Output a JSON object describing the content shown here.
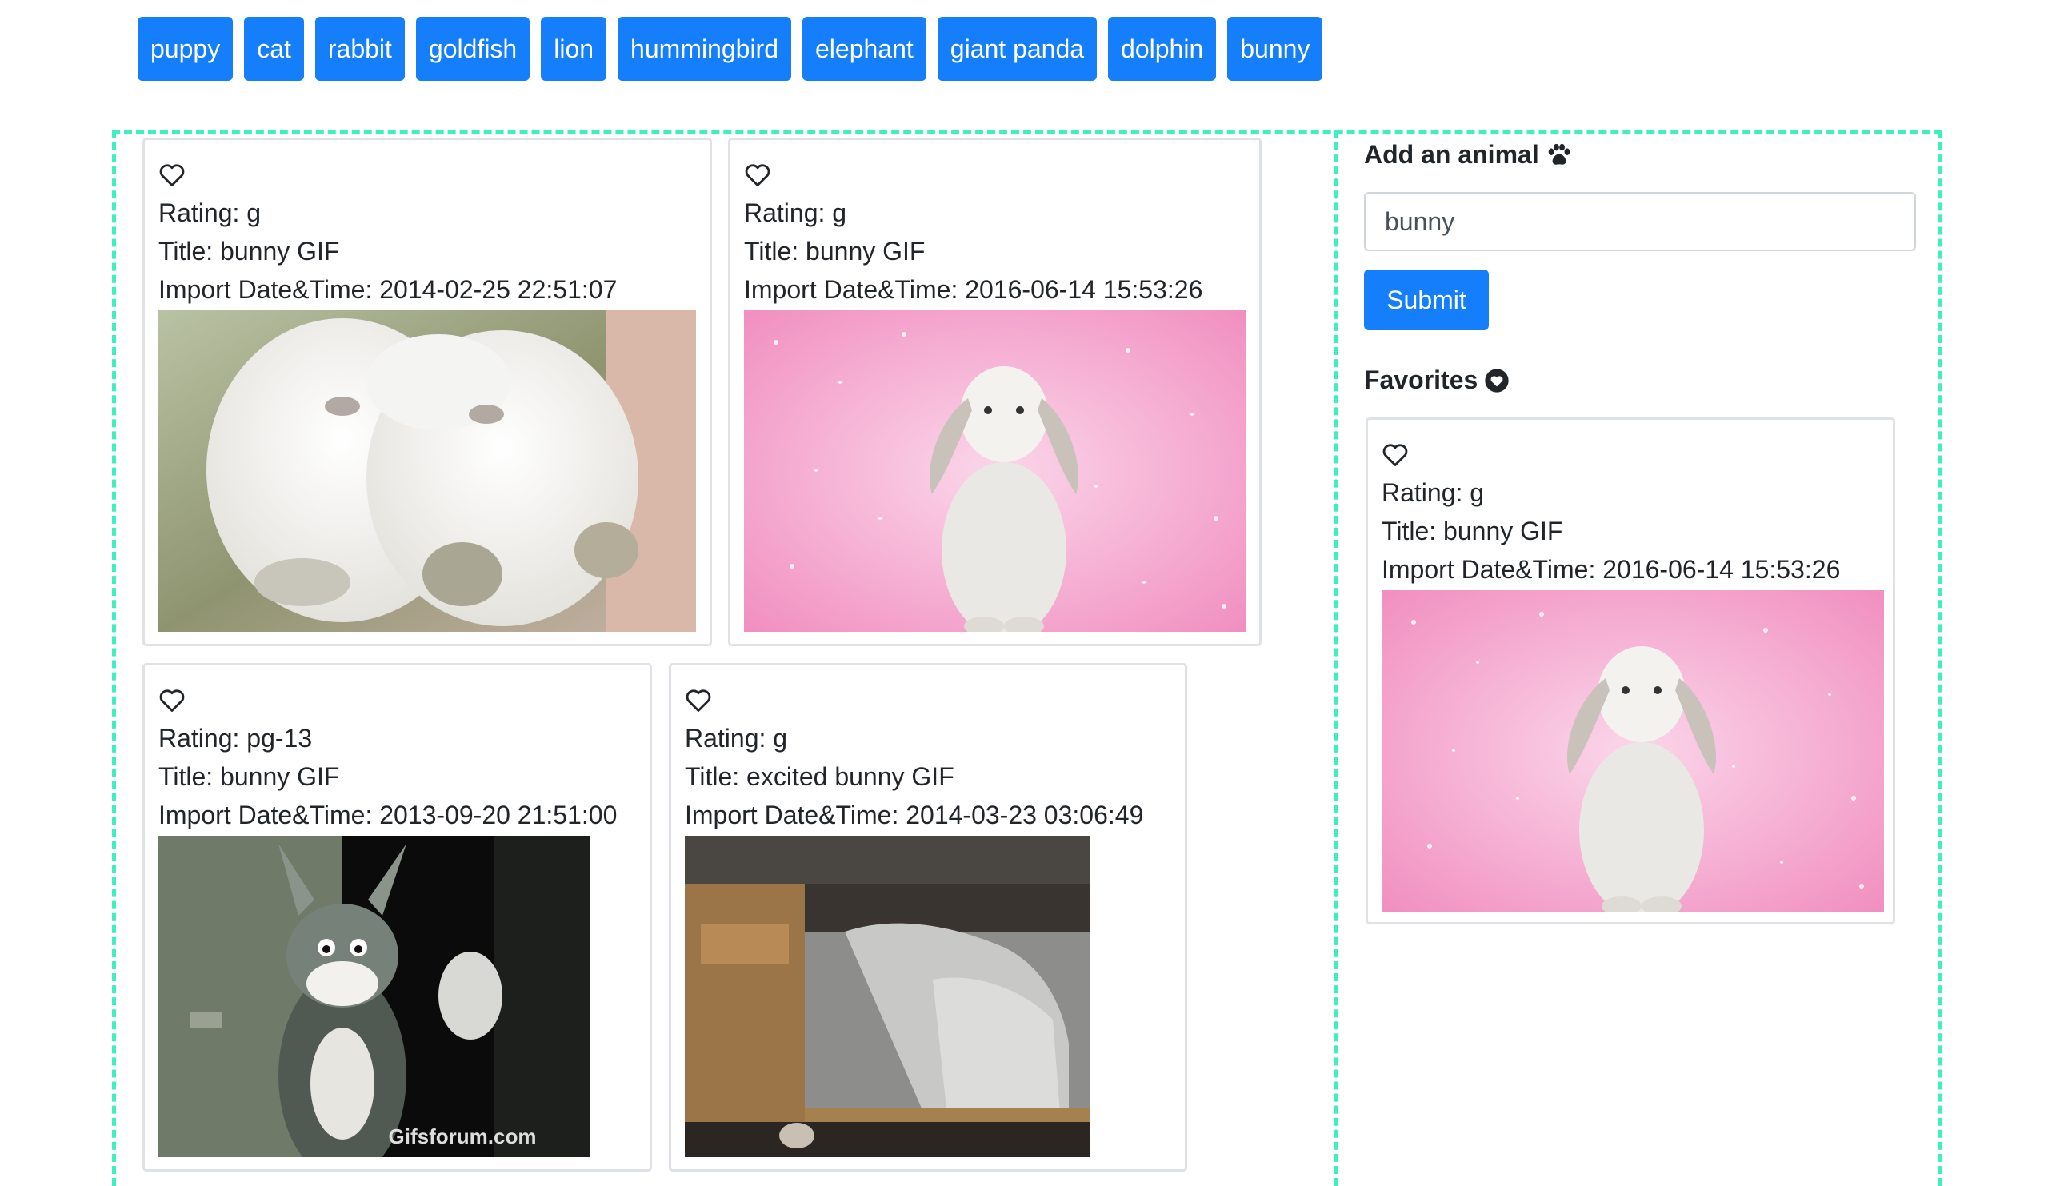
{
  "topics": [
    "puppy",
    "cat",
    "rabbit",
    "goldfish",
    "lion",
    "hummingbird",
    "elephant",
    "giant panda",
    "dolphin",
    "bunny"
  ],
  "add_animal": {
    "title": "Add an animal",
    "input_value": "bunny",
    "submit_label": "Submit"
  },
  "favorites": {
    "title": "Favorites"
  },
  "labels": {
    "rating": "Rating: ",
    "title": "Title: ",
    "import": "Import Date&Time: "
  },
  "gifs": [
    {
      "rating": "g",
      "title": "bunny GIF",
      "import_datetime": "2014-02-25 22:51:07"
    },
    {
      "rating": "g",
      "title": "bunny GIF",
      "import_datetime": "2016-06-14 15:53:26"
    },
    {
      "rating": "pg-13",
      "title": "bunny GIF",
      "import_datetime": "2013-09-20 21:51:00",
      "watermark": "Gifsforum.com"
    },
    {
      "rating": "g",
      "title": "excited bunny GIF",
      "import_datetime": "2014-03-23 03:06:49"
    }
  ],
  "favorite_gifs": [
    {
      "rating": "g",
      "title": "bunny GIF",
      "import_datetime": "2016-06-14 15:53:26"
    }
  ],
  "colors": {
    "primary": "#157efb",
    "dashed_border": "#3cf0c0",
    "card_border": "#dee2e6"
  }
}
